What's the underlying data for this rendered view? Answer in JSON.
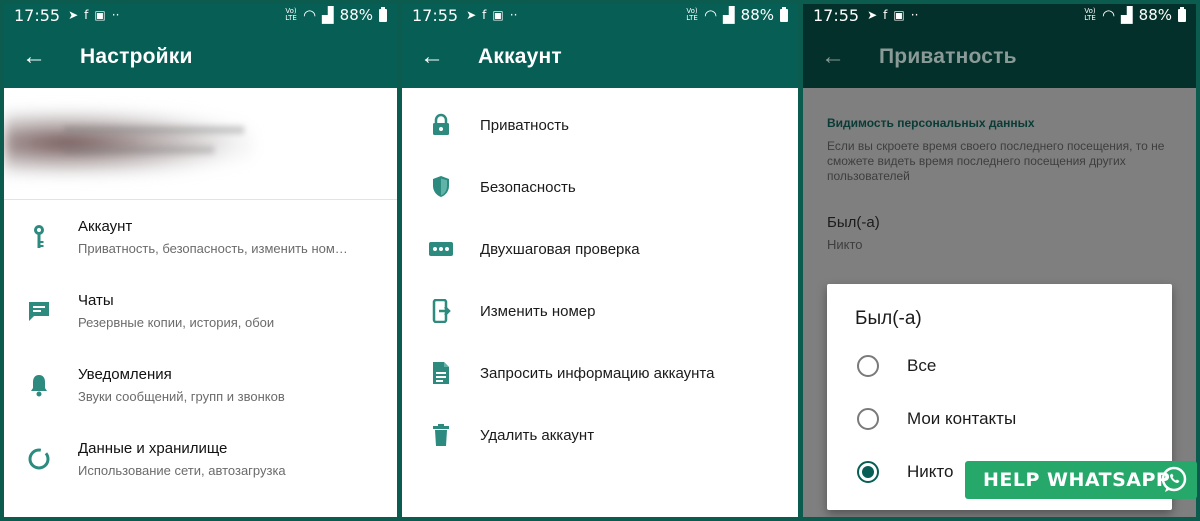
{
  "status": {
    "time": "17:55",
    "volte": "Vo) LTE",
    "battery": "88%",
    "more": "··"
  },
  "settings": {
    "title": "Настройки",
    "items": [
      {
        "title": "Аккаунт",
        "subtitle": "Приватность, безопасность, изменить ном…",
        "icon": "key-icon"
      },
      {
        "title": "Чаты",
        "subtitle": "Резервные копии, история, обои",
        "icon": "chat-icon"
      },
      {
        "title": "Уведомления",
        "subtitle": "Звуки сообщений, групп и звонков",
        "icon": "bell-icon"
      },
      {
        "title": "Данные и хранилище",
        "subtitle": "Использование сети, автозагрузка",
        "icon": "data-usage-icon"
      }
    ]
  },
  "account": {
    "title": "Аккаунт",
    "items": [
      {
        "label": "Приватность",
        "icon": "lock-icon"
      },
      {
        "label": "Безопасность",
        "icon": "shield-icon"
      },
      {
        "label": "Двухшаговая проверка",
        "icon": "dots-icon"
      },
      {
        "label": "Изменить номер",
        "icon": "phone-change-icon"
      },
      {
        "label": "Запросить информацию аккаунта",
        "icon": "document-icon"
      },
      {
        "label": "Удалить аккаунт",
        "icon": "trash-icon"
      }
    ]
  },
  "privacy": {
    "title": "Приватность",
    "section_header": "Видимость персональных данных",
    "description": "Если вы скроете время своего последнего посещения, то не сможете видеть время последнего посещения других пользователей",
    "last_seen_label": "Был(-а)",
    "last_seen_value": "Никто",
    "dialog": {
      "title": "Был(-а)",
      "options": [
        {
          "label": "Все",
          "selected": false
        },
        {
          "label": "Мои контакты",
          "selected": false
        },
        {
          "label": "Никто",
          "selected": true
        }
      ]
    }
  },
  "watermark": "HELP WHATSAPP",
  "colors": {
    "primary": "#075e54",
    "icon": "#2c8a7e",
    "badge": "#25a86a"
  }
}
